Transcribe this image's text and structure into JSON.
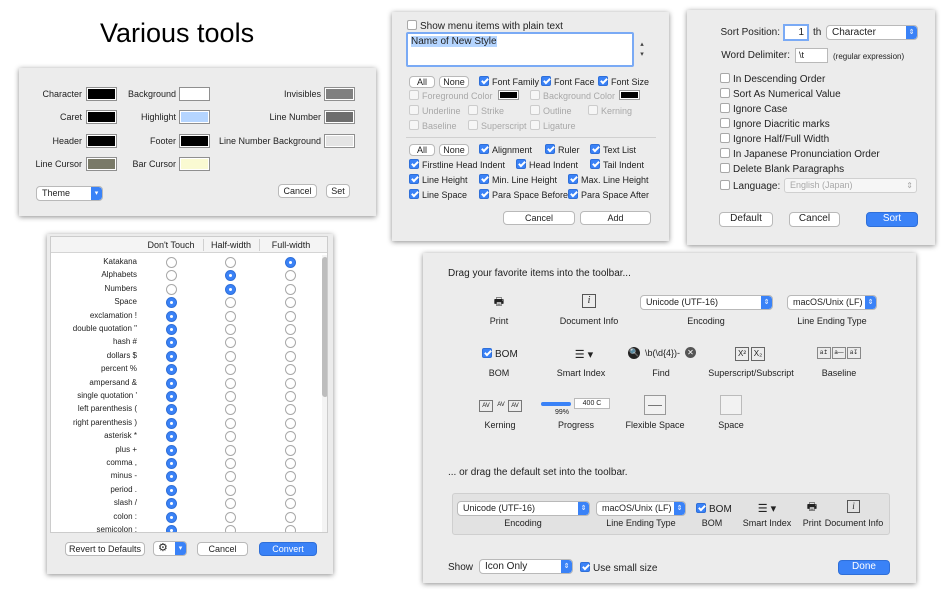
{
  "heading": "Various tools",
  "theme_panel": {
    "colors": [
      {
        "label": "Character",
        "color": "#000000"
      },
      {
        "label": "Background",
        "color": "#ffffff"
      },
      {
        "label": "Invisibles",
        "color": "#808080"
      },
      {
        "label": "Caret",
        "color": "#000000"
      },
      {
        "label": "Highlight",
        "color": "#b5d5ff"
      },
      {
        "label": "Line Number",
        "color": "#6e6e6e"
      },
      {
        "label": "Header",
        "color": "#000000"
      },
      {
        "label": "Footer",
        "color": "#000000"
      },
      {
        "label": "Line Number Background",
        "color": "#e4e4e4"
      },
      {
        "label": "Line Cursor",
        "color": "#7a7a68"
      },
      {
        "label": "Bar Cursor",
        "color": "#fafad2"
      }
    ],
    "theme_select": "Theme",
    "cancel": "Cancel",
    "set": "Set"
  },
  "style_panel": {
    "plain_text_label": "Show menu items with plain text",
    "style_name": "Name of New Style",
    "all": "All",
    "none": "None",
    "font_options": [
      {
        "label": "Font Family",
        "checked": true,
        "disabled": false
      },
      {
        "label": "Font Face",
        "checked": true,
        "disabled": false
      },
      {
        "label": "Font Size",
        "checked": true,
        "disabled": false
      },
      {
        "label": "Foreground Color",
        "checked": false,
        "disabled": true
      },
      {
        "label": "Background Color",
        "checked": false,
        "disabled": true
      },
      {
        "label": "Underline",
        "checked": false,
        "disabled": true
      },
      {
        "label": "Strike",
        "checked": false,
        "disabled": true
      },
      {
        "label": "Outline",
        "checked": false,
        "disabled": true
      },
      {
        "label": "Kerning",
        "checked": false,
        "disabled": true
      },
      {
        "label": "Baseline",
        "checked": false,
        "disabled": true
      },
      {
        "label": "Superscript",
        "checked": false,
        "disabled": true
      },
      {
        "label": "Ligature",
        "checked": false,
        "disabled": true
      }
    ],
    "para_options": [
      {
        "label": "Alignment",
        "checked": true
      },
      {
        "label": "Ruler",
        "checked": true
      },
      {
        "label": "Text List",
        "checked": true
      },
      {
        "label": "Firstline Head Indent",
        "checked": true
      },
      {
        "label": "Head Indent",
        "checked": true
      },
      {
        "label": "Tail Indent",
        "checked": true
      },
      {
        "label": "Line Height",
        "checked": true
      },
      {
        "label": "Min. Line Height",
        "checked": true
      },
      {
        "label": "Max. Line Height",
        "checked": true
      },
      {
        "label": "Line Space",
        "checked": true
      },
      {
        "label": "Para Space Before",
        "checked": true
      },
      {
        "label": "Para Space After",
        "checked": true
      }
    ],
    "cancel": "Cancel",
    "add": "Add"
  },
  "sort_panel": {
    "sort_position_label": "Sort Position:",
    "sort_position_value": "1",
    "th": "th",
    "sort_by": "Character",
    "word_delimiter_label": "Word Delimiter:",
    "word_delimiter_value": "\\t",
    "regex_note": "(regular expression)",
    "options": [
      {
        "label": "In Descending Order",
        "checked": false
      },
      {
        "label": "Sort As Numerical Value",
        "checked": false
      },
      {
        "label": "Ignore Case",
        "checked": false
      },
      {
        "label": "Ignore Diacritic marks",
        "checked": false
      },
      {
        "label": "Ignore Half/Full Width",
        "checked": false
      },
      {
        "label": "In Japanese Pronunciation Order",
        "checked": false
      },
      {
        "label": "Delete Blank Paragraphs",
        "checked": false
      }
    ],
    "language_label": "Language:",
    "language_value": "English (Japan)",
    "default": "Default",
    "cancel": "Cancel",
    "sort": "Sort"
  },
  "width_panel": {
    "columns": [
      "Don't Touch",
      "Half-width",
      "Full-width"
    ],
    "rows": [
      {
        "label": "Katakana",
        "selected": 2
      },
      {
        "label": "Alphabets",
        "selected": 1
      },
      {
        "label": "Numbers",
        "selected": 1
      },
      {
        "label": "Space",
        "selected": 0
      },
      {
        "label": "exclamation  !",
        "selected": 0
      },
      {
        "label": "double quotation  \"",
        "selected": 0
      },
      {
        "label": "hash  #",
        "selected": 0
      },
      {
        "label": "dollars  $",
        "selected": 0
      },
      {
        "label": "percent  %",
        "selected": 0
      },
      {
        "label": "ampersand  &",
        "selected": 0
      },
      {
        "label": "single quotation  '",
        "selected": 0
      },
      {
        "label": "left parenthesis  (",
        "selected": 0
      },
      {
        "label": "right parenthesis  )",
        "selected": 0
      },
      {
        "label": "asterisk  *",
        "selected": 0
      },
      {
        "label": "plus  +",
        "selected": 0
      },
      {
        "label": "comma  ,",
        "selected": 0
      },
      {
        "label": "minus  -",
        "selected": 0
      },
      {
        "label": "period  .",
        "selected": 0
      },
      {
        "label": "slash  /",
        "selected": 0
      },
      {
        "label": "colon  :",
        "selected": 0
      },
      {
        "label": "semicolon  ;",
        "selected": 0
      }
    ],
    "revert": "Revert to Defaults",
    "cancel": "Cancel",
    "convert": "Convert"
  },
  "toolbar_panel": {
    "drag_text": "Drag your favorite items into the toolbar...",
    "items": {
      "print": "Print",
      "document_info": "Document Info",
      "encoding_value": "Unicode (UTF-16)",
      "encoding": "Encoding",
      "line_ending_value": "macOS/Unix (LF)",
      "line_ending": "Line Ending Type",
      "bom_check": "BOM",
      "bom": "BOM",
      "smart_index": "Smart Index",
      "find_value": "\\b(\\d{4})-",
      "find": "Find",
      "super_sub": "Superscript/Subscript",
      "baseline": "Baseline",
      "kerning": "Kerning",
      "progress_percent": "99%",
      "progress_value": 0.99,
      "progress_field": "400 C",
      "progress": "Progress",
      "flexible_space": "Flexible Space",
      "space": "Space"
    },
    "default_text": "... or drag the default set into the toolbar.",
    "show_label": "Show",
    "show_value": "Icon Only",
    "small_size": "Use small size",
    "done": "Done"
  }
}
